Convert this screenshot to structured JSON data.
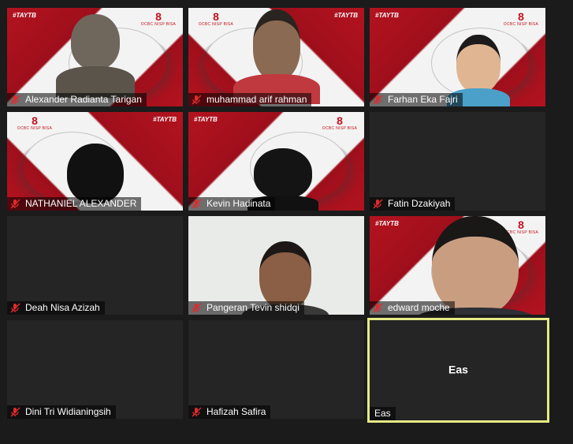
{
  "brand": {
    "tag": "#TAYTB",
    "logo_mark": "8",
    "logo_text": "OCBC NISP BISA",
    "accent": "#b3131f"
  },
  "participants": [
    {
      "name": "Alexander Radianta Tarigan",
      "muted": true,
      "video": true
    },
    {
      "name": "muhammad arif rahman",
      "muted": true,
      "video": true
    },
    {
      "name": "Farhan Eka Fajri",
      "muted": true,
      "video": true
    },
    {
      "name": "NATHANIEL ALEXANDER",
      "muted": true,
      "video": true
    },
    {
      "name": "Kevin Hadinata",
      "muted": true,
      "video": true
    },
    {
      "name": "Fatin Dzakiyah",
      "muted": true,
      "video": false
    },
    {
      "name": "Deah Nisa Azizah",
      "muted": true,
      "video": false
    },
    {
      "name": "Pangeran Tevin shidqi",
      "muted": true,
      "video": true
    },
    {
      "name": "edward moche",
      "muted": true,
      "video": true
    },
    {
      "name": "Dini Tri Widianingsih",
      "muted": true,
      "video": false
    },
    {
      "name": "Hafizah Safira",
      "muted": true,
      "video": false
    },
    {
      "name": "Eas",
      "muted": false,
      "video": false,
      "active_speaker": true
    }
  ],
  "icons": {
    "muted": "mic-muted-icon"
  },
  "colors": {
    "active_border": "#e6ea86",
    "tile_bg": "#252525",
    "page_bg": "#1b1b1b"
  }
}
